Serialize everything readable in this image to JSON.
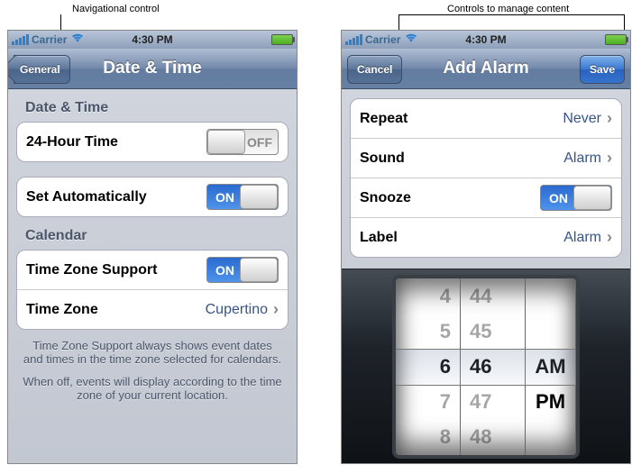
{
  "annotations": {
    "left": "Navigational control",
    "right": "Controls to manage content"
  },
  "statusBar": {
    "carrier": "Carrier",
    "time": "4:30 PM"
  },
  "left": {
    "backButton": "General",
    "title": "Date & Time",
    "sections": {
      "dateTimeHeader": "Date & Time",
      "calendarHeader": "Calendar"
    },
    "rows": {
      "twentyFourHour": {
        "label": "24-Hour Time",
        "toggle": "OFF"
      },
      "setAuto": {
        "label": "Set Automatically",
        "toggle": "ON"
      },
      "tzSupport": {
        "label": "Time Zone Support",
        "toggle": "ON"
      },
      "timeZone": {
        "label": "Time Zone",
        "value": "Cupertino"
      }
    },
    "footer1": "Time Zone Support always shows event dates and times in the time zone selected for calendars.",
    "footer2": "When off, events will display according to the time zone of your current location."
  },
  "right": {
    "cancel": "Cancel",
    "save": "Save",
    "title": "Add Alarm",
    "rows": {
      "repeat": {
        "label": "Repeat",
        "value": "Never"
      },
      "sound": {
        "label": "Sound",
        "value": "Alarm"
      },
      "snooze": {
        "label": "Snooze",
        "toggle": "ON"
      },
      "labelRow": {
        "label": "Label",
        "value": "Alarm"
      }
    },
    "picker": {
      "hours": [
        "4",
        "5",
        "6",
        "7",
        "8"
      ],
      "minutes": [
        "44",
        "45",
        "46",
        "47",
        "48"
      ],
      "ampm": [
        "",
        "",
        "AM",
        "PM",
        ""
      ]
    }
  }
}
